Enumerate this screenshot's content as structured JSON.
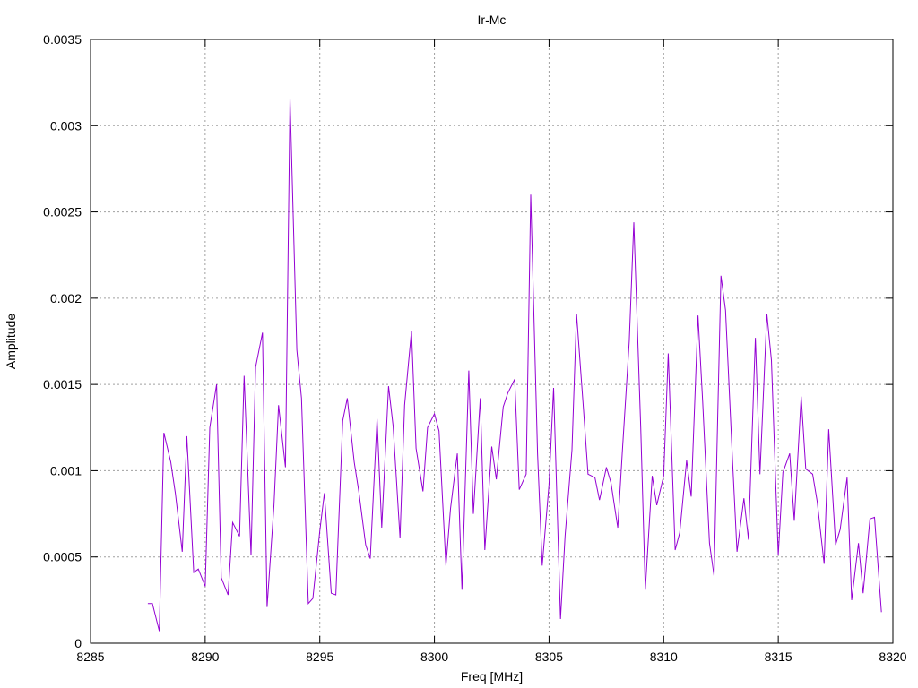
{
  "chart_data": {
    "type": "line",
    "title": "Ir-Mc",
    "xlabel": "Freq [MHz]",
    "ylabel": "Amplitude",
    "xlim": [
      8285,
      8320
    ],
    "ylim": [
      0,
      0.0035
    ],
    "x_ticks": [
      "8285",
      "8290",
      "8295",
      "8300",
      "8305",
      "8310",
      "8315",
      "8320"
    ],
    "y_ticks": [
      "0",
      "0.0005",
      "0.001",
      "0.0015",
      "0.002",
      "0.0025",
      "0.003",
      "0.0035"
    ],
    "grid": true,
    "legend": "none",
    "series": [
      {
        "color": "#9400d3",
        "x": [
          8287.5,
          8287.7,
          8288.0,
          8288.2,
          8288.5,
          8288.7,
          8289.0,
          8289.2,
          8289.5,
          8289.7,
          8290.0,
          8290.2,
          8290.5,
          8290.7,
          8291.0,
          8291.2,
          8291.5,
          8291.7,
          8292.0,
          8292.2,
          8292.5,
          8292.7,
          8293.0,
          8293.2,
          8293.5,
          8293.7,
          8294.0,
          8294.2,
          8294.5,
          8294.7,
          8295.0,
          8295.2,
          8295.5,
          8295.7,
          8296.0,
          8296.2,
          8296.5,
          8296.7,
          8297.0,
          8297.2,
          8297.5,
          8297.7,
          8298.0,
          8298.2,
          8298.5,
          8298.7,
          8299.0,
          8299.2,
          8299.5,
          8299.7,
          8300.0,
          8300.2,
          8300.5,
          8300.7,
          8301.0,
          8301.2,
          8301.5,
          8301.7,
          8302.0,
          8302.2,
          8302.5,
          8302.7,
          8303.0,
          8303.2,
          8303.5,
          8303.7,
          8304.0,
          8304.2,
          8304.5,
          8304.7,
          8305.0,
          8305.2,
          8305.5,
          8305.7,
          8306.0,
          8306.2,
          8306.5,
          8306.7,
          8307.0,
          8307.2,
          8307.5,
          8307.7,
          8308.0,
          8308.2,
          8308.5,
          8308.7,
          8309.0,
          8309.2,
          8309.5,
          8309.7,
          8310.0,
          8310.2,
          8310.5,
          8310.7,
          8311.0,
          8311.2,
          8311.5,
          8311.7,
          8312.0,
          8312.2,
          8312.5,
          8312.7,
          8313.0,
          8313.2,
          8313.5,
          8313.7,
          8314.0,
          8314.2,
          8314.5,
          8314.7,
          8315.0,
          8315.2,
          8315.5,
          8315.7,
          8316.0,
          8316.2,
          8316.5,
          8316.7,
          8317.0,
          8317.2,
          8317.5,
          8317.7,
          8318.0,
          8318.2,
          8318.5,
          8318.7,
          8319.0,
          8319.2,
          8319.5
        ],
        "values": [
          0.00023,
          0.00023,
          7e-05,
          0.00122,
          0.00105,
          0.00087,
          0.00053,
          0.0012,
          0.00041,
          0.00043,
          0.00033,
          0.00125,
          0.0015,
          0.00038,
          0.00028,
          0.0007,
          0.00062,
          0.00155,
          0.00051,
          0.0016,
          0.0018,
          0.00021,
          0.0008,
          0.00138,
          0.00102,
          0.00316,
          0.0017,
          0.00142,
          0.00023,
          0.00026,
          0.00065,
          0.00087,
          0.00029,
          0.00028,
          0.00129,
          0.00142,
          0.00105,
          0.00088,
          0.00057,
          0.00049,
          0.0013,
          0.00067,
          0.00149,
          0.00126,
          0.00061,
          0.00138,
          0.00181,
          0.00113,
          0.00088,
          0.00125,
          0.00133,
          0.00123,
          0.00045,
          0.00078,
          0.0011,
          0.00031,
          0.00158,
          0.00075,
          0.00142,
          0.00054,
          0.00114,
          0.00095,
          0.00137,
          0.00145,
          0.00153,
          0.00089,
          0.00098,
          0.0026,
          0.0011,
          0.00045,
          0.00092,
          0.00148,
          0.00014,
          0.00062,
          0.00112,
          0.00191,
          0.00136,
          0.00098,
          0.00096,
          0.00083,
          0.00102,
          0.00093,
          0.00067,
          0.00112,
          0.00175,
          0.00244,
          0.00125,
          0.00031,
          0.00097,
          0.0008,
          0.00097,
          0.00168,
          0.00054,
          0.00064,
          0.00106,
          0.00085,
          0.0019,
          0.0014,
          0.00058,
          0.00039,
          0.00213,
          0.00193,
          0.00107,
          0.00053,
          0.00084,
          0.0006,
          0.00177,
          0.00098,
          0.00191,
          0.00164,
          0.00051,
          0.00099,
          0.0011,
          0.00071,
          0.00143,
          0.00101,
          0.00098,
          0.00082,
          0.00046,
          0.00124,
          0.00057,
          0.00066,
          0.00096,
          0.00025,
          0.00058,
          0.00029,
          0.00072,
          0.00073,
          0.00018
        ]
      }
    ]
  }
}
